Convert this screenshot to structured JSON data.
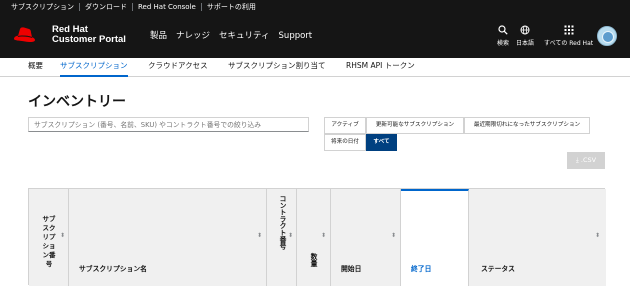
{
  "utility_nav": [
    "サブスクリプション",
    "ダウンロード",
    "Red Hat Console",
    "サポートの利用"
  ],
  "brand": {
    "line1": "Red Hat",
    "line2": "Customer Portal",
    "hat_color": "#ee0000"
  },
  "main_nav": [
    "製品",
    "ナレッジ",
    "セキュリティ",
    "Support"
  ],
  "tools": {
    "search": "検索",
    "language": "日本語",
    "apps": "すべての Red Hat"
  },
  "sub_nav": {
    "items": [
      "概要",
      "サブスクリプション",
      "クラウドアクセス",
      "サブスクリプション割り当て",
      "RHSM API トークン"
    ],
    "active_index": 1
  },
  "page_title": "インベントリー",
  "search": {
    "placeholder": "サブスクリプション (番号、名前、SKU) やコントラクト番号での絞り込み"
  },
  "filters": {
    "items": [
      "アクティブ",
      "更新可能なサブスクリプション",
      "最近期限切れになったサブスクリプション",
      "将来の日付",
      "すべて"
    ],
    "selected_index": 4
  },
  "csv_button": "CSV",
  "table": {
    "columns": [
      "サブスクリプション番号",
      "サブスクリプション名",
      "コントラクト番号",
      "数量",
      "開始日",
      "終了日",
      "ステータス"
    ],
    "sorted_column_index": 5
  },
  "colors": {
    "accent": "#0066cc",
    "dark_bar": "#151515",
    "selected_filter": "#004080"
  }
}
